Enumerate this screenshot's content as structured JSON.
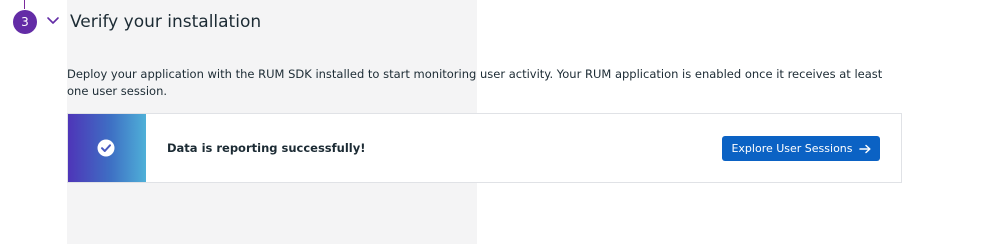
{
  "step": {
    "number": "3",
    "title": "Verify your installation",
    "description": "Deploy your application with the RUM SDK installed to start monitoring user activity. Your RUM application is enabled once it receives at least one user session.",
    "badge_color": "#632ca6"
  },
  "status": {
    "message": "Data is reporting successfully!",
    "icon": "check-circle-icon"
  },
  "actions": {
    "explore_label": "Explore User Sessions",
    "explore_icon": "arrow-right-icon",
    "explore_color": "#0b62c4"
  }
}
